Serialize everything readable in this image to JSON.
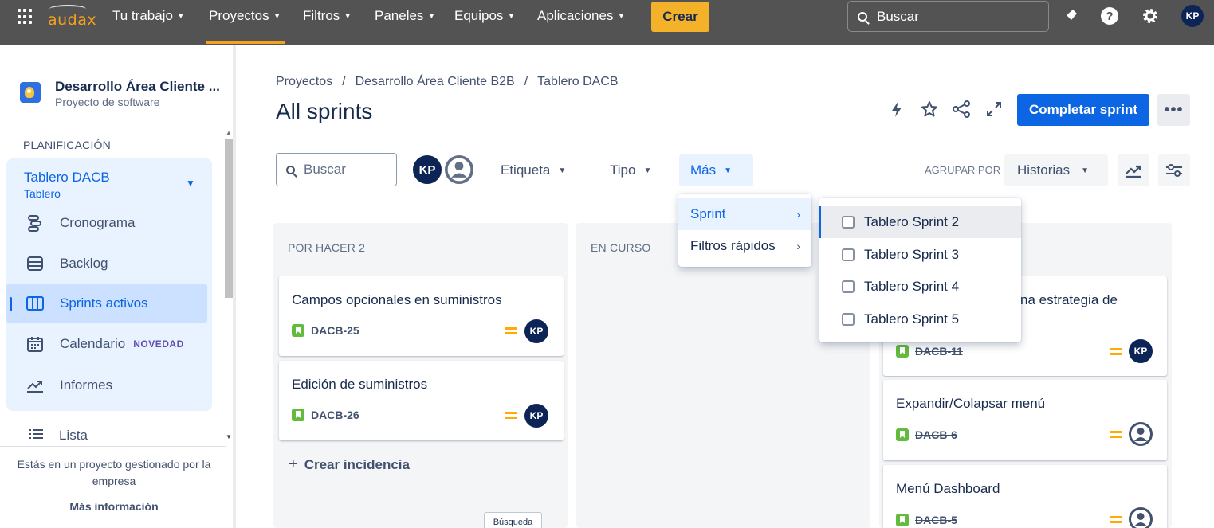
{
  "topnav": {
    "logo_text": "audax",
    "items": [
      {
        "label": "Tu trabajo"
      },
      {
        "label": "Proyectos"
      },
      {
        "label": "Filtros"
      },
      {
        "label": "Paneles"
      },
      {
        "label": "Equipos"
      },
      {
        "label": "Aplicaciones"
      }
    ],
    "create_label": "Crear",
    "search_placeholder": "Buscar",
    "avatar_initials": "KP",
    "brand_color": "#f4a11e"
  },
  "sidebar": {
    "project_name": "Desarrollo Área Cliente ...",
    "project_type": "Proyecto de software",
    "section_title": "PLANIFICACIÓN",
    "board_title": "Tablero DACB",
    "board_sub": "Tablero",
    "items": [
      {
        "label": "Cronograma",
        "icon": "timeline-icon"
      },
      {
        "label": "Backlog",
        "icon": "backlog-icon"
      },
      {
        "label": "Sprints activos",
        "icon": "board-columns-icon"
      },
      {
        "label": "Calendario",
        "icon": "calendar-icon",
        "badge": "NOVEDAD"
      },
      {
        "label": "Informes",
        "icon": "reports-icon"
      }
    ],
    "lista_label": "Lista",
    "managed_text": "Estás en un proyecto gestionado por la empresa",
    "more_info": "Más información"
  },
  "main": {
    "breadcrumb": [
      "Proyectos",
      "Desarrollo Área Cliente B2B",
      "Tablero DACB"
    ],
    "breadcrumb_sep": "/",
    "title": "All sprints",
    "complete_sprint": "Completar sprint",
    "search_placeholder": "Buscar",
    "filter_avatar": "KP",
    "filters": {
      "etiqueta": "Etiqueta",
      "tipo": "Tipo",
      "mas": "Más"
    },
    "group_by_label": "AGRUPAR POR",
    "group_by_value": "Historias"
  },
  "columns": [
    {
      "title": "POR HACER 2",
      "cards": [
        {
          "title": "Campos opcionales en suministros",
          "key": "DACB-25",
          "assignee": "KP"
        },
        {
          "title": "Edición de suministros",
          "key": "DACB-26",
          "assignee": "KP"
        }
      ],
      "create_label": "Crear incidencia"
    },
    {
      "title": "EN CURSO",
      "cards": []
    },
    {
      "title": "",
      "cards": [
        {
          "title": "na estrategia de",
          "key": "DACB-11",
          "assignee": "KP"
        },
        {
          "title": "Expandir/Colapsar menú",
          "key": "DACB-6",
          "assignee": ""
        },
        {
          "title": "Menú Dashboard",
          "key": "DACB-5",
          "assignee": ""
        }
      ]
    }
  ],
  "mas_menu": [
    {
      "label": "Sprint"
    },
    {
      "label": "Filtros rápidos"
    }
  ],
  "sprint_submenu": [
    {
      "label": "Tablero Sprint 2",
      "checked": false
    },
    {
      "label": "Tablero Sprint 3",
      "checked": false
    },
    {
      "label": "Tablero Sprint 4",
      "checked": false
    },
    {
      "label": "Tablero Sprint 5",
      "checked": false
    }
  ],
  "tooltip": "Búsqueda",
  "colors": {
    "primary": "#0c66e4",
    "story_green": "#63ba3c",
    "priority": "#ffab00"
  }
}
